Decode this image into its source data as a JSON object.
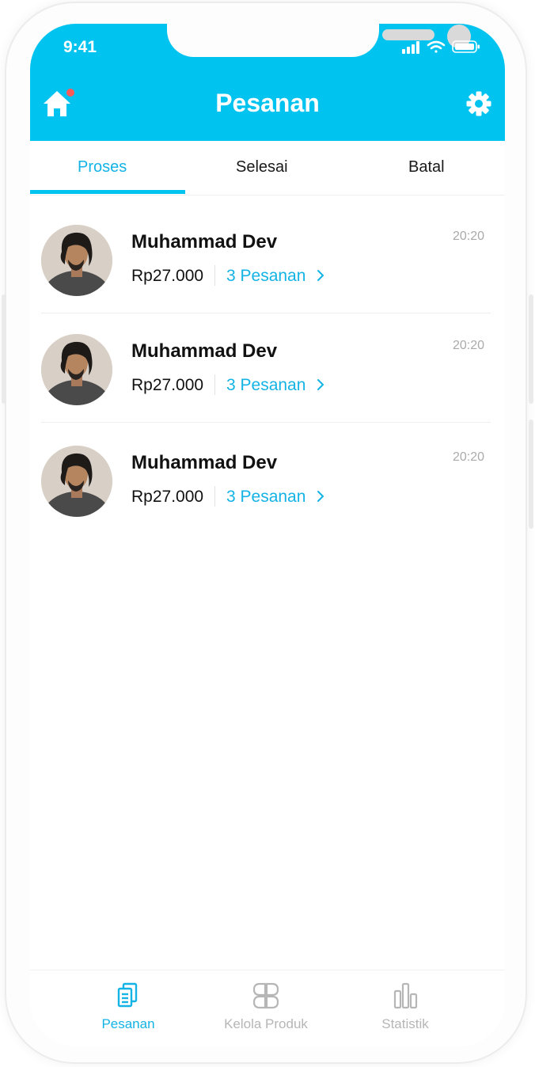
{
  "status_bar": {
    "time": "9:41"
  },
  "header": {
    "title": "Pesanan"
  },
  "tabs": [
    {
      "label": "Proses",
      "active": true
    },
    {
      "label": "Selesai",
      "active": false
    },
    {
      "label": "Batal",
      "active": false
    }
  ],
  "orders": [
    {
      "name": "Muhammad Dev",
      "price": "Rp27.000",
      "count": "3 Pesanan",
      "time": "20:20"
    },
    {
      "name": "Muhammad Dev",
      "price": "Rp27.000",
      "count": "3 Pesanan",
      "time": "20:20"
    },
    {
      "name": "Muhammad Dev",
      "price": "Rp27.000",
      "count": "3 Pesanan",
      "time": "20:20"
    }
  ],
  "bottom_nav": [
    {
      "label": "Pesanan",
      "icon": "orders-icon",
      "active": true
    },
    {
      "label": "Kelola Produk",
      "icon": "products-icon",
      "active": false
    },
    {
      "label": "Statistik",
      "icon": "statistics-icon",
      "active": false
    }
  ],
  "colors": {
    "primary": "#00c3ef",
    "accent_text": "#14b3e5",
    "notification": "#ff5a5a",
    "muted": "#b6b6b6"
  }
}
